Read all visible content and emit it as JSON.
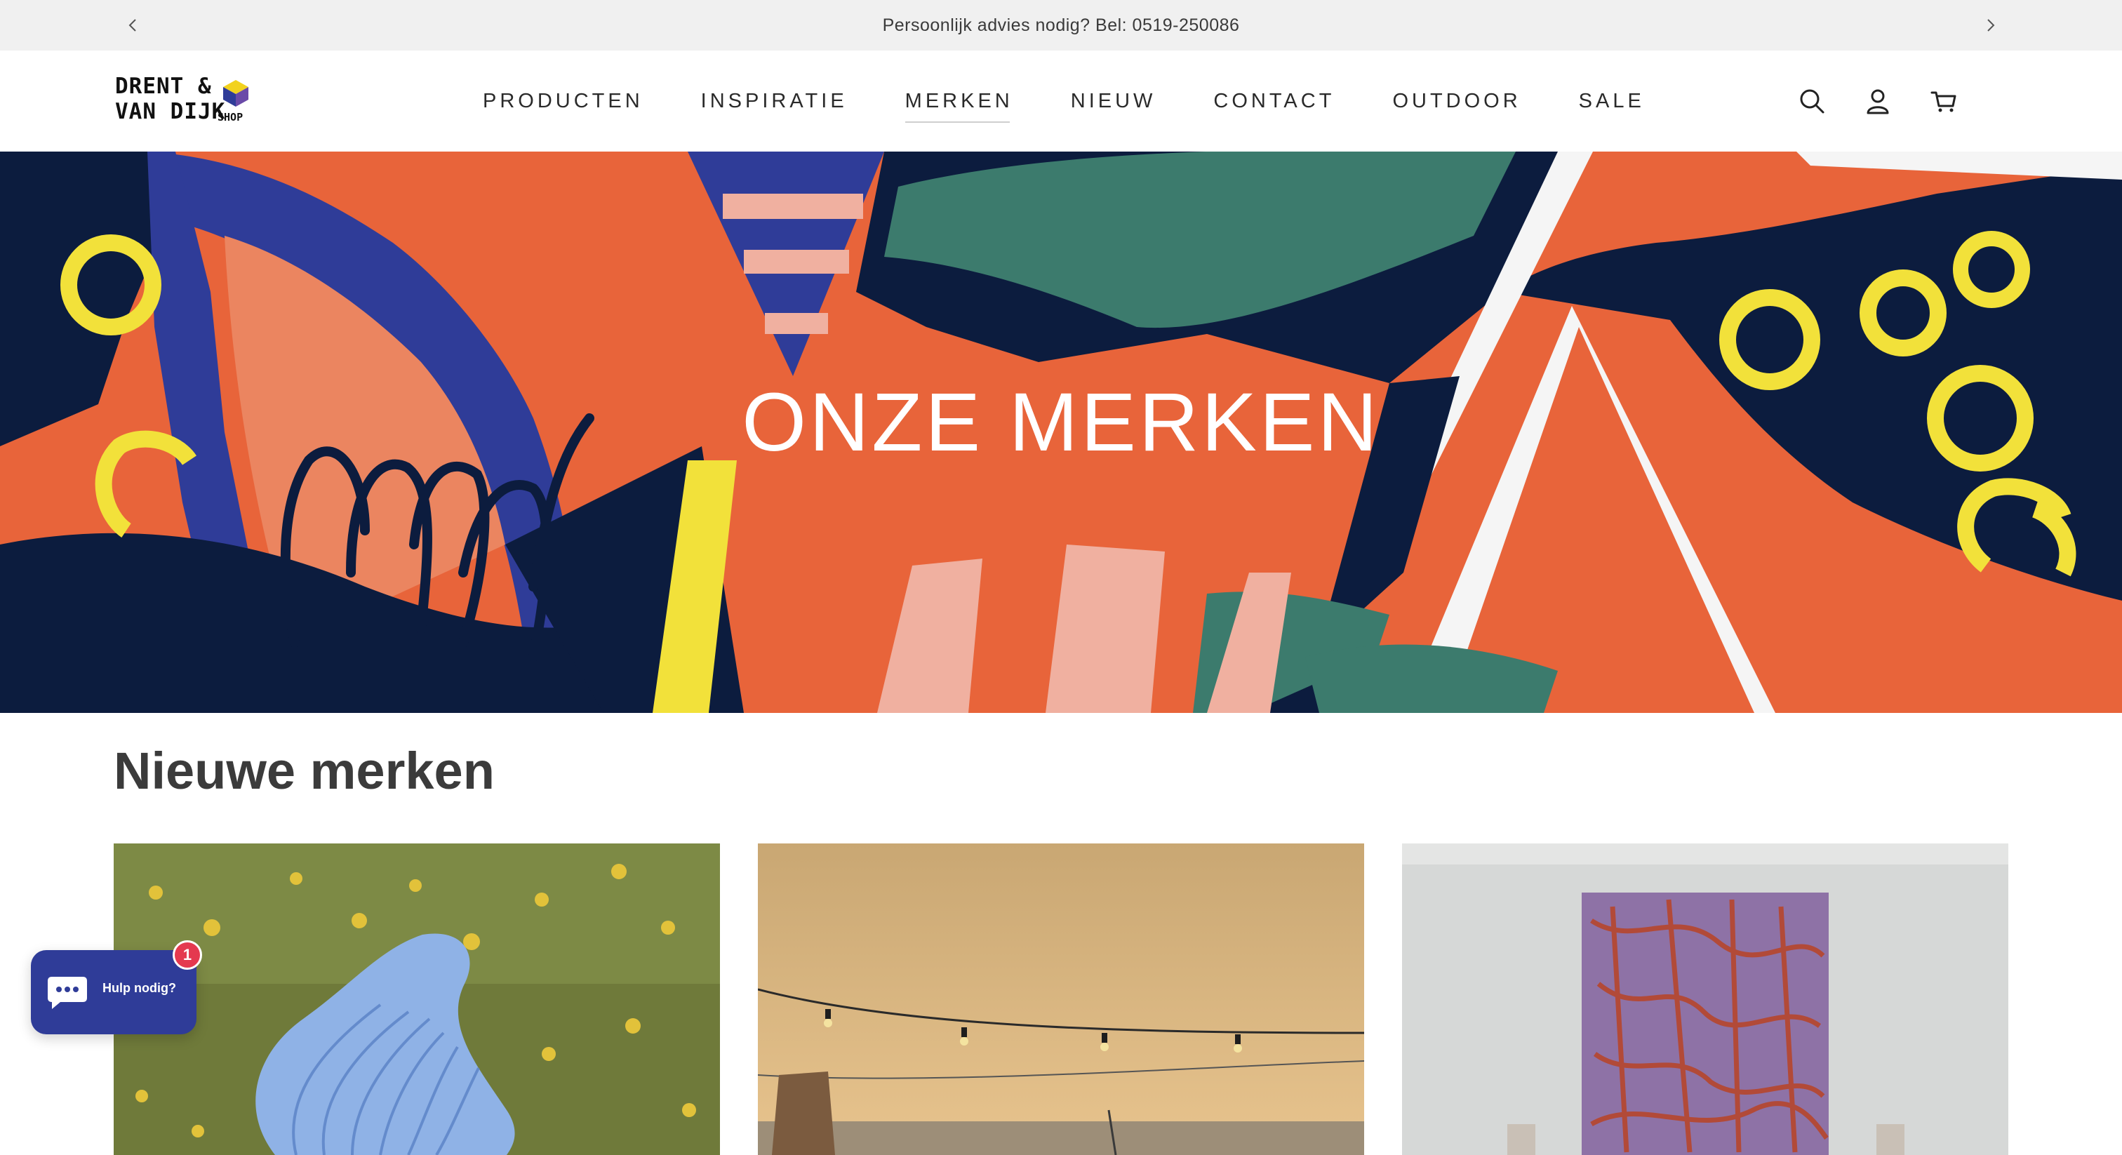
{
  "announcement": {
    "text": "Persoonlijk advies nodig? Bel: 0519-250086"
  },
  "logo": {
    "line1": "DRENT &",
    "line2": "VAN DIJK",
    "shop": "SHOP"
  },
  "nav": {
    "items": [
      {
        "label": "PRODUCTEN"
      },
      {
        "label": "INSPIRATIE"
      },
      {
        "label": "MERKEN"
      },
      {
        "label": "NIEUW"
      },
      {
        "label": "CONTACT"
      },
      {
        "label": "OUTDOOR"
      },
      {
        "label": "SALE"
      }
    ],
    "active": "MERKEN"
  },
  "header_icons": [
    "search-icon",
    "account-icon",
    "cart-icon"
  ],
  "hero": {
    "title": "ONZE MERKEN"
  },
  "section": {
    "title": "Nieuwe merken"
  },
  "chat": {
    "label": "Hulp nodig?",
    "badge": "1"
  },
  "colors": {
    "navy": "#0c1c3e",
    "orange": "#e8643a",
    "blue": "#2f3c98",
    "green": "#3c7b6d",
    "yellow": "#f2e13a",
    "pink": "#f0b0a0",
    "chat_badge": "#e4394f"
  }
}
